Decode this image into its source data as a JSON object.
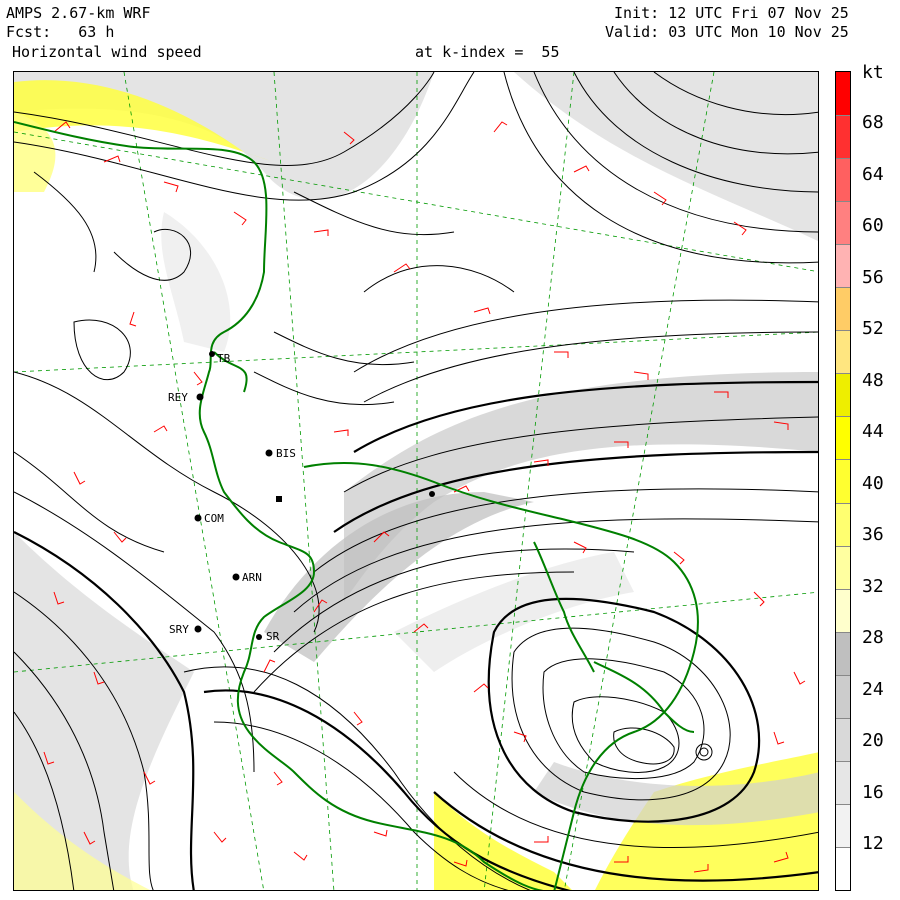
{
  "header": {
    "model": "AMPS 2.67-km WRF",
    "forecast": "Fcst:   63 h",
    "field": "Horizontal wind speed",
    "init": "Init: 12 UTC Fri 07 Nov 25",
    "valid": "Valid: 03 UTC Mon 10 Nov 25",
    "level": "at k-index =  55"
  },
  "colorbar": {
    "unit": "kt",
    "ticks": [
      "68",
      "64",
      "60",
      "56",
      "52",
      "48",
      "44",
      "40",
      "36",
      "32",
      "28",
      "24",
      "20",
      "16",
      "12"
    ],
    "colors": [
      "#ffffff",
      "#f2f2f2",
      "#e6e6e6",
      "#d9d9d9",
      "#cccccc",
      "#bfbfbf",
      "#ffffcc",
      "#ffffa0",
      "#ffff70",
      "#ffff30",
      "#ffff00",
      "#eeee00",
      "#ffe680",
      "#ffcc66",
      "#ffb3b3",
      "#ff8080",
      "#ff6060",
      "#ff3030",
      "#ff0000"
    ]
  },
  "stations": [
    "REY",
    "BIS",
    "COM",
    "ARN",
    "SRY",
    "TB",
    "SR"
  ],
  "map": {
    "coastline_color": "#008000",
    "barb_color": "#ff0000",
    "streamline_color": "#000000",
    "grid_color": "#009900"
  }
}
